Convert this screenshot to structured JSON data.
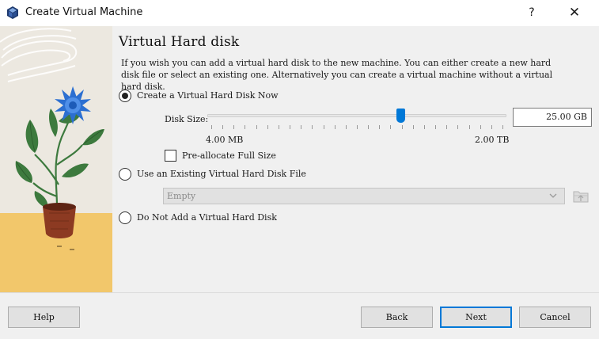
{
  "window": {
    "title": "Create Virtual Machine",
    "help_glyph": "?",
    "close_glyph": "✕"
  },
  "page": {
    "heading": "Virtual Hard disk",
    "description": "If you wish you can add a virtual hard disk to the new machine. You can either create a new hard disk file or select an existing one. Alternatively you can create a virtual machine without a virtual hard disk."
  },
  "options": {
    "create_new": {
      "label": "Create a Virtual Hard Disk Now",
      "selected": true
    },
    "use_existing": {
      "label": "Use an Existing Virtual Hard Disk File",
      "selected": false
    },
    "no_disk": {
      "label": "Do Not Add a Virtual Hard Disk",
      "selected": false
    }
  },
  "disk_size": {
    "label": "Disk Size:",
    "value": "25.00 GB",
    "slider_position": 0.65,
    "min_label": "4.00 MB",
    "max_label": "2.00 TB"
  },
  "preallocate": {
    "label": "Pre-allocate Full Size",
    "checked": false
  },
  "existing_file": {
    "selected_value": "Empty"
  },
  "buttons": {
    "help": "Help",
    "back": "Back",
    "next": "Next",
    "cancel": "Cancel"
  },
  "colors": {
    "accent": "#0078d7",
    "illustration_bg": "#ece8e0",
    "illustration_floor": "#f2c76b",
    "flower": "#2c6fd1",
    "leaf": "#3d7a3e",
    "pot": "#8c3a22"
  },
  "icons": {
    "app": "virtualbox-cube-icon",
    "folder": "folder-open-icon",
    "dropdown": "chevron-down-icon"
  }
}
